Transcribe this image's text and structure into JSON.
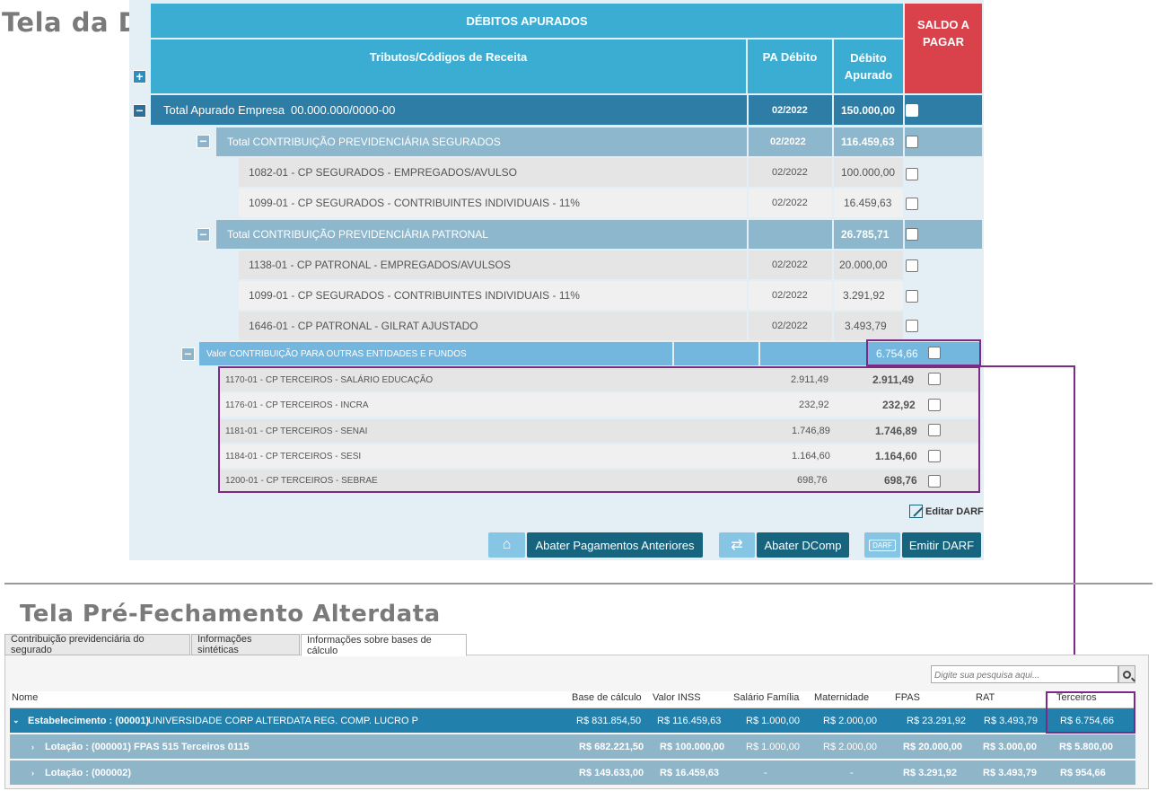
{
  "top_title": "Tela da DCTFWeb",
  "header": {
    "debitos": "DÉBITOS APURADOS",
    "saldo": "SALDO A PAGAR",
    "tributos": "Tributos/Códigos de Receita",
    "pa": "PA Débito",
    "debito": "Débito Apurado"
  },
  "total": {
    "label": "Total Apurado Empresa",
    "cnpj": "00.000.000/0000-00",
    "pa": "02/2022",
    "valor": "150.000,00"
  },
  "segurados": {
    "label": "Total CONTRIBUIÇÃO PREVIDENCIÁRIA SEGURADOS",
    "pa": "02/2022",
    "valor": "116.459,63",
    "items": [
      {
        "label": "1082-01 - CP SEGURADOS - EMPREGADOS/AVULSO",
        "pa": "02/2022",
        "valor": "100.000,00"
      },
      {
        "label": "1099-01 - CP SEGURADOS - CONTRIBUINTES INDIVIDUAIS - 11%",
        "pa": "02/2022",
        "valor": "16.459,63"
      }
    ]
  },
  "patronal": {
    "label": "Total CONTRIBUIÇÃO PREVIDENCIÁRIA PATRONAL",
    "valor": "26.785,71",
    "items": [
      {
        "label": "1138-01 - CP PATRONAL - EMPREGADOS/AVULSOS",
        "pa": "02/2022",
        "valor": "20.000,00"
      },
      {
        "label": "1099-01 - CP SEGURADOS - CONTRIBUINTES INDIVIDUAIS - 11%",
        "pa": "02/2022",
        "valor": "3.291,92"
      },
      {
        "label": "1646-01 - CP PATRONAL - GILRAT AJUSTADO",
        "pa": "02/2022",
        "valor": "3.493,79"
      }
    ]
  },
  "terceiros": {
    "label": "Valor CONTRIBUIÇÃO PARA OUTRAS ENTIDADES E FUNDOS",
    "valor": "6.754,66",
    "items": [
      {
        "label": "1170-01 - CP TERCEIROS - SALÁRIO EDUCAÇÃO",
        "base": "2.911,49",
        "valor": "2.911,49"
      },
      {
        "label": "1176-01 - CP TERCEIROS - INCRA",
        "base": "232,92",
        "valor": "232,92"
      },
      {
        "label": "1181-01 - CP TERCEIROS - SENAI",
        "base": "1.746,89",
        "valor": "1.746,89"
      },
      {
        "label": "1184-01 - CP TERCEIROS - SESI",
        "base": "1.164,60",
        "valor": "1.164,60"
      },
      {
        "label": "1200-01 - CP TERCEIROS - SEBRAE",
        "base": "698,76",
        "valor": "698,76"
      }
    ]
  },
  "actions": {
    "editar": "Editar DARF",
    "abater_pag": "Abater Pagamentos Anteriores",
    "abater_dcomp": "Abater DComp",
    "emitir": "Emitir DARF",
    "darf_icon_text": "DARF"
  },
  "bottom_title": "Tela Pré-Fechamento Alterdata",
  "tabs": [
    "Contribuição previdenciária do segurado",
    "Informações sintéticas",
    "Informações sobre bases de cálculo"
  ],
  "search_placeholder": "Digite sua pesquisa aqui...",
  "grid": {
    "columns": [
      "Nome",
      "Base de cálculo",
      "Valor INSS",
      "Salário Família",
      "Maternidade",
      "FPAS",
      "RAT",
      "Terceiros"
    ],
    "rows": [
      {
        "nome_label": "Estabelecimento : (00001)",
        "nome_value": "UNIVERSIDADE CORP ALTERDATA REG. COMP. LUCRO P",
        "base": "R$ 831.854,50",
        "inss": "R$ 116.459,63",
        "salfam": "R$ 1.000,00",
        "mat": "R$ 2.000,00",
        "fpas": "R$ 23.291,92",
        "rat": "R$ 3.493,79",
        "terc": "R$ 6.754,66"
      },
      {
        "nome_label": "Lotação : (000001) FPAS 515 Terceiros 0115",
        "base": "R$ 682.221,50",
        "inss": "R$ 100.000,00",
        "salfam": "R$ 1.000,00",
        "mat": "R$ 2.000,00",
        "fpas": "R$ 20.000,00",
        "rat": "R$ 3.000,00",
        "terc": "R$ 5.800,00"
      },
      {
        "nome_label": "Lotação : (000002)",
        "base": "R$ 149.633,00",
        "inss": "R$ 16.459,63",
        "salfam": "-",
        "mat": "-",
        "fpas": "R$ 3.291,92",
        "rat": "R$ 3.493,79",
        "terc": "R$ 954,66"
      }
    ]
  },
  "colors": {
    "header": "#3badd3",
    "saldo": "#d9424a",
    "total_row": "#2e7da6",
    "sub_row": "#8cb7cc",
    "button": "#17647f",
    "highlight": "#7b2a86",
    "grid_row": "#2280ad"
  }
}
